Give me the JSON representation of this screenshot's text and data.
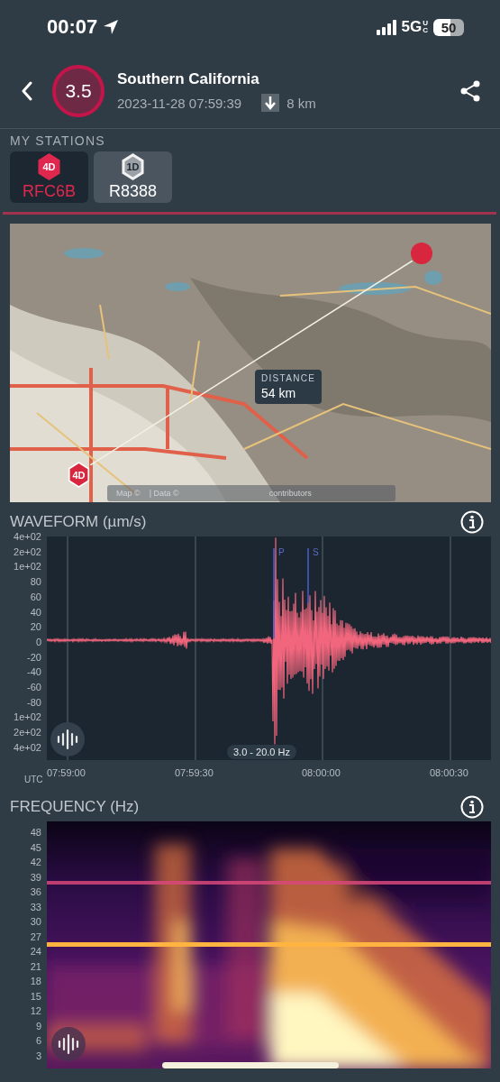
{
  "status_bar": {
    "time": "00:07",
    "network": "5G",
    "network_suffix": "UC",
    "battery": "50"
  },
  "event": {
    "magnitude": "3.5",
    "region": "Southern California",
    "datetime": "2023-11-28 07:59:39",
    "depth": "8 km"
  },
  "stations": {
    "title": "MY STATIONS",
    "items": [
      {
        "badge": "4D",
        "name": "RFC6B",
        "selected": true
      },
      {
        "badge": "1D",
        "name": "R8388",
        "selected": false
      }
    ]
  },
  "map": {
    "marker": "4D",
    "distance_label": "DISTANCE",
    "distance": "54 km",
    "attribution": [
      "Map ©",
      "| Data ©",
      "contributors"
    ]
  },
  "waveform": {
    "title": "WAVEFORM (µm/s)",
    "y_ticks": [
      "4e+02",
      "2e+02",
      "1e+02",
      "80",
      "60",
      "40",
      "20",
      "0",
      "-20",
      "-40",
      "-60",
      "-80",
      "1e+02",
      "2e+02",
      "4e+02"
    ],
    "x_ticks": [
      "07:59:00",
      "07:59:30",
      "08:00:00",
      "08:00:30"
    ],
    "time_zone": "UTC",
    "phases": [
      "P",
      "S"
    ],
    "band": "3.0 - 20.0 Hz"
  },
  "frequency": {
    "title": "FREQUENCY (Hz)",
    "y_ticks": [
      "48",
      "45",
      "42",
      "39",
      "36",
      "33",
      "30",
      "27",
      "24",
      "21",
      "18",
      "15",
      "12",
      "9",
      "6",
      "3"
    ]
  }
}
